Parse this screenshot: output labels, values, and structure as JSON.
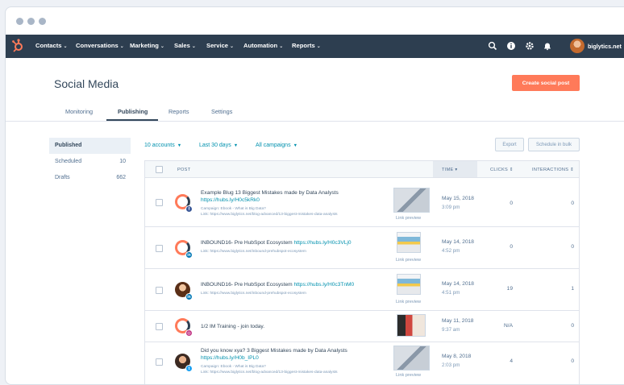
{
  "nav": {
    "items": [
      "Contacts",
      "Conversations",
      "Marketing",
      "Sales",
      "Service",
      "Automation",
      "Reports"
    ],
    "caret": "⌄",
    "account_name": "biglytics.net"
  },
  "page": {
    "title": "Social Media",
    "create_button": "Create social post"
  },
  "tabs": [
    "Monitoring",
    "Publishing",
    "Reports",
    "Settings"
  ],
  "sidebar": {
    "items": [
      {
        "label": "Published",
        "count": ""
      },
      {
        "label": "Scheduled",
        "count": "10"
      },
      {
        "label": "Drafts",
        "count": "662"
      }
    ]
  },
  "filters": {
    "accounts": "10 accounts",
    "range": "Last 30 days",
    "campaigns": "All campaigns",
    "export": "Export",
    "schedule_bulk": "Schedule in bulk"
  },
  "table": {
    "headers": {
      "post": "POST",
      "time": "TIME",
      "clicks": "CLICKS",
      "interactions": "INTERACTIONS"
    },
    "sort_arrows": "⇕",
    "sort_down": "▾",
    "link_preview": "Link preview",
    "rows": [
      {
        "text": "Example Blug 13 Biggest Mistakes made by Data Analysts",
        "link": "https://hubs.ly/H0c5kRk0",
        "meta1": "Campaign: Ebook - What is Big Data?",
        "meta2": "Link: https://www.biglytics.net/blog-advanced/13-biggest-mistakes-data-analysts",
        "date": "May 15, 2018",
        "time": "3:09 pm",
        "clicks": "0",
        "interactions": "0"
      },
      {
        "text": "INBOUND16- Pre HubSpot Ecosystem",
        "link": "https://hubs.ly/H0c3VLj0",
        "meta1": "Link: https://www.biglytics.net/inbound-prehubspot-ecosystem",
        "meta2": "",
        "date": "May 14, 2018",
        "time": "4:52 pm",
        "clicks": "0",
        "interactions": "0"
      },
      {
        "text": "INBOUND16- Pre HubSpot Ecosystem",
        "link": "https://hubs.ly/H0c3TnM0",
        "meta1": "Link: https://www.biglytics.net/inbound-prehubspot-ecosystem",
        "meta2": "",
        "date": "May 14, 2018",
        "time": "4:51 pm",
        "clicks": "19",
        "interactions": "1"
      },
      {
        "text": "1/2 IM Training - join today.",
        "link": "",
        "meta1": "",
        "meta2": "",
        "date": "May 11, 2018",
        "time": "9:37 am",
        "clicks": "N/A",
        "interactions": "0"
      },
      {
        "text": "Did you know xya? 3 Biggest Mistakes made by Data Analysts",
        "link": "https://hubs.ly/H0b_IPL0",
        "meta1": "Campaign: Ebook - What is Big Data?",
        "meta2": "Link: https://www.biglytics.net/blog-advanced/13-biggest-mistakes-data-analysts",
        "date": "May 8, 2018",
        "time": "2:03 pm",
        "clicks": "4",
        "interactions": "0"
      }
    ]
  },
  "colors": {
    "nav_bg": "#2d3e50",
    "accent": "#ff7a59",
    "link": "#0091ae"
  }
}
